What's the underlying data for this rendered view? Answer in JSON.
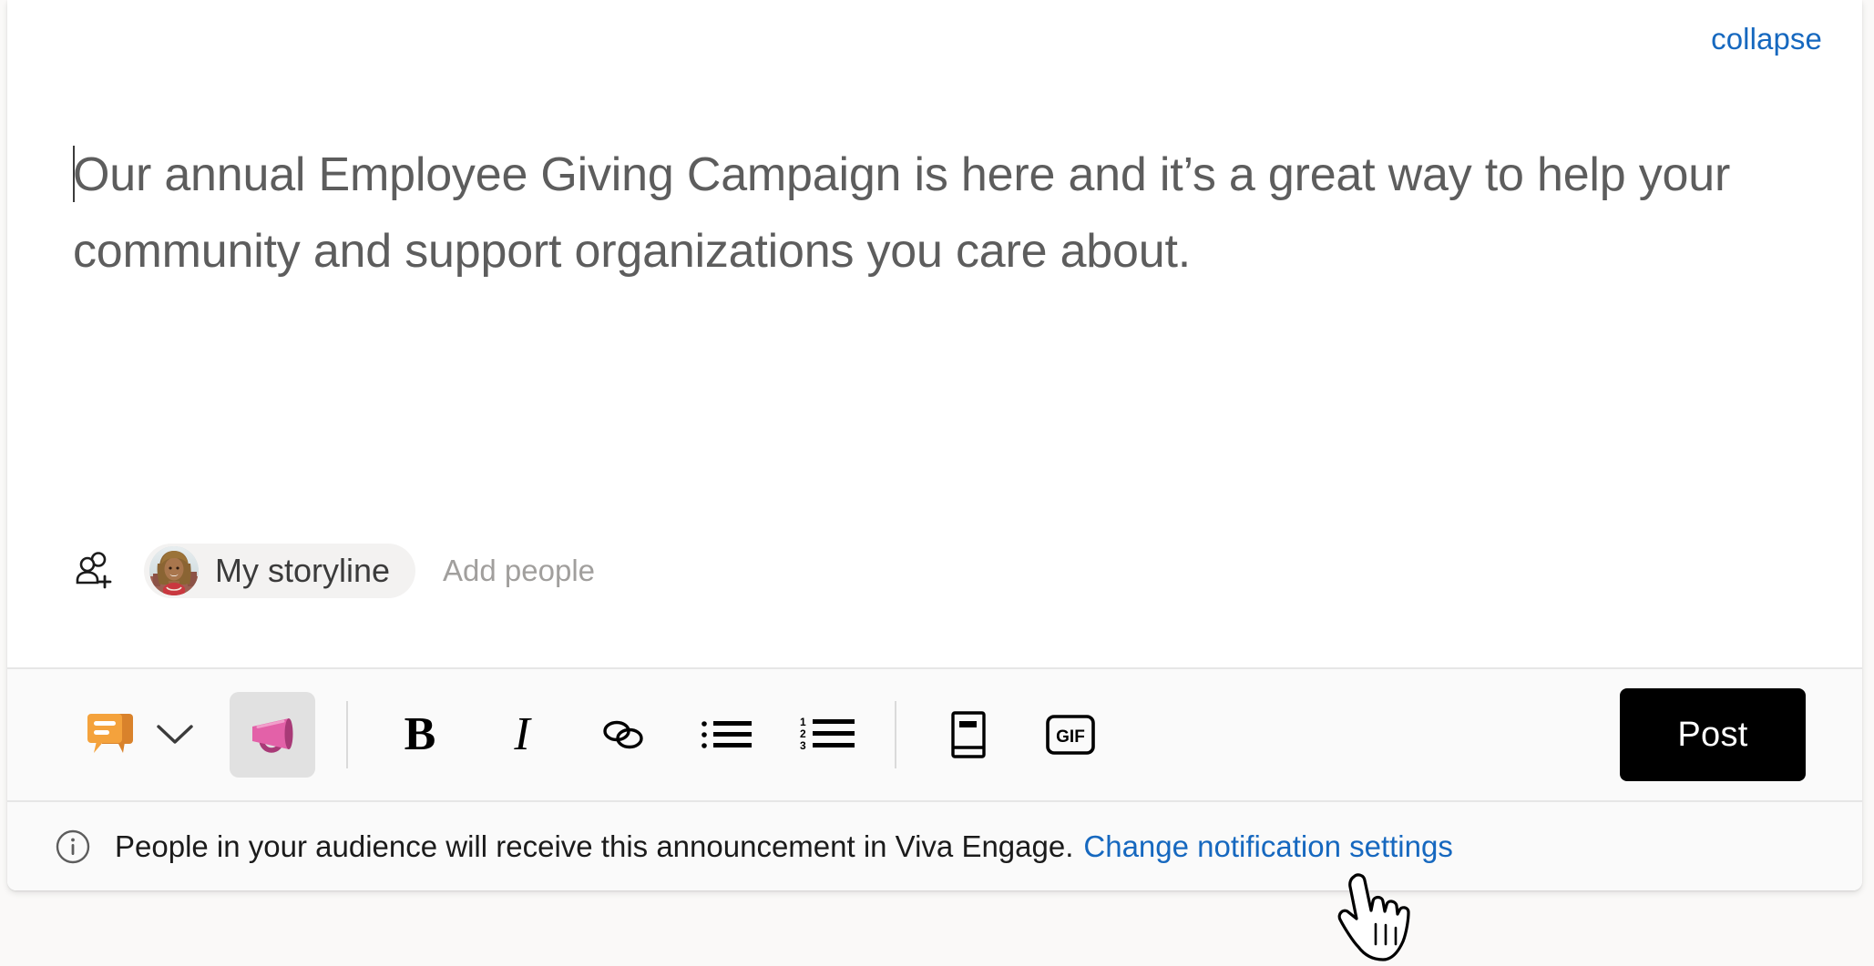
{
  "card": {
    "collapse_label": "collapse"
  },
  "editor": {
    "body_text": "Our annual Employee Giving Campaign is here and it’s a great way to help your community and support organizations you care about.",
    "caret_visible": true
  },
  "audience": {
    "add_audience_icon": "add-people-icon",
    "selected_pill_label": "My storyline",
    "avatar_icon": "user-avatar-photo",
    "add_people_placeholder": "Add people"
  },
  "toolbar": {
    "post_type": {
      "icon": "discussion-icon",
      "chevron_icon": "chevron-down-icon"
    },
    "items": [
      {
        "name": "announcement-button",
        "icon": "megaphone-icon",
        "selected": true
      },
      {
        "name": "bold-button",
        "icon": "bold-icon",
        "glyph": "B"
      },
      {
        "name": "italic-button",
        "icon": "italic-icon",
        "glyph": "I"
      },
      {
        "name": "link-button",
        "icon": "link-icon"
      },
      {
        "name": "bulleted-list-button",
        "icon": "bulleted-list-icon"
      },
      {
        "name": "numbered-list-button",
        "icon": "numbered-list-icon",
        "markers": [
          "1",
          "2",
          "3"
        ]
      },
      {
        "name": "praise-button",
        "icon": "book-icon"
      },
      {
        "name": "gif-button",
        "icon": "gif-icon",
        "glyph": "GIF"
      }
    ],
    "post_label": "Post"
  },
  "notice": {
    "icon": "info-circle-icon",
    "text": "People in your audience will receive this announcement in Viva Engage.",
    "link_label": "Change notification settings"
  },
  "cursor": {
    "icon": "pointing-hand-cursor"
  },
  "colors": {
    "link_blue": "#1668bf",
    "page_background": "#faf9f8",
    "card_background": "#ffffff",
    "toolbar_background": "#fafafa",
    "post_button_background": "#000000",
    "post_button_text": "#ffffff",
    "body_text": "#5d5d5d",
    "placeholder_text": "#a19f9d",
    "discussion_icon_orange": "#f0962e",
    "megaphone_icon_pink": "#e361a8",
    "selected_chip_background": "#e1e1e1"
  }
}
